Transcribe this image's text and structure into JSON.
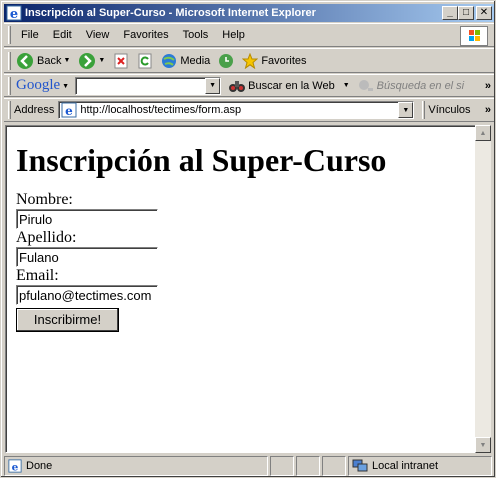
{
  "window": {
    "title": "Inscripción al Super-Curso - Microsoft Internet Explorer"
  },
  "menu": [
    "File",
    "Edit",
    "View",
    "Favorites",
    "Tools",
    "Help"
  ],
  "toolbar": {
    "back": "Back",
    "media": "Media",
    "favorites": "Favorites"
  },
  "google_bar": {
    "logo": "Google",
    "search_web": "Buscar en la Web",
    "search_site": "Búsqueda en el si"
  },
  "address_bar": {
    "label": "Address",
    "url": "http://localhost/tectimes/form.asp",
    "links": "Vínculos"
  },
  "page": {
    "heading": "Inscripción al Super-Curso",
    "fields": [
      {
        "label": "Nombre:",
        "value": "Pirulo"
      },
      {
        "label": "Apellido:",
        "value": "Fulano"
      },
      {
        "label": "Email:",
        "value": "pfulano@tectimes.com"
      }
    ],
    "submit_label": "Inscribirme!"
  },
  "status_bar": {
    "text": "Done",
    "zone": "Local intranet"
  }
}
